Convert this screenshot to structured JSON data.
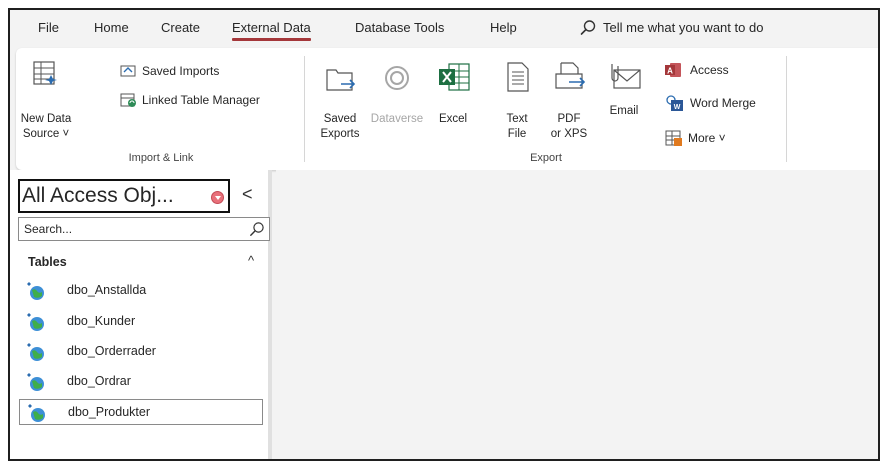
{
  "menu": {
    "items": [
      {
        "label": "File",
        "active": false
      },
      {
        "label": "Home",
        "active": false
      },
      {
        "label": "Create",
        "active": false
      },
      {
        "label": "External Data",
        "active": true
      },
      {
        "label": "Database Tools",
        "active": false
      },
      {
        "label": "Help",
        "active": false
      }
    ],
    "tell_me": "Tell me what you want to do",
    "accent": "#a4373a"
  },
  "ribbon": {
    "import_link": {
      "label": "Import & Link",
      "new_data_source_line1": "New Data",
      "new_data_source_line2": "Source ˅",
      "saved_imports": "Saved Imports",
      "linked_table_manager": "Linked Table Manager"
    },
    "export": {
      "label": "Export",
      "saved_exports_line1": "Saved",
      "saved_exports_line2": "Exports",
      "dataverse": "Dataverse",
      "excel": "Excel",
      "text_file_line1": "Text",
      "text_file_line2": "File",
      "pdf_line1": "PDF",
      "pdf_line2": "or XPS",
      "email": "Email",
      "access": "Access",
      "word_merge": "Word Merge",
      "more": "More ˅"
    }
  },
  "nav": {
    "title": "All Access Obj...",
    "collapse_glyph": "<",
    "search_placeholder": "Search...",
    "group": "Tables",
    "group_chevron": "^",
    "tables": [
      {
        "name": "dbo_Anstallda",
        "selected": false
      },
      {
        "name": "dbo_Kunder",
        "selected": false
      },
      {
        "name": "dbo_Orderrader",
        "selected": false
      },
      {
        "name": "dbo_Ordrar",
        "selected": false
      },
      {
        "name": "dbo_Produkter",
        "selected": true
      }
    ]
  },
  "colors": {
    "excel_green": "#1d6f42",
    "access_red": "#a4373a",
    "icon_blue": "#2b6cb0",
    "dropdown_red": "#e8707a"
  },
  "icons": [
    "search-icon",
    "new-data-source-icon",
    "saved-imports-icon",
    "linked-table-manager-icon",
    "saved-exports-icon",
    "dataverse-icon",
    "excel-icon",
    "text-file-icon",
    "pdf-icon",
    "email-icon",
    "access-icon",
    "word-merge-icon",
    "more-icon",
    "linked-table-icon"
  ]
}
